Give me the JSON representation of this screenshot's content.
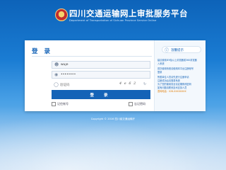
{
  "header": {
    "title": "四川交通运输网上审批服务平台",
    "subtitle": "Department of Transportation of Sichuan Province Service Online",
    "emblem_icon": "emblem-icon"
  },
  "login": {
    "title": "登 录",
    "username": {
      "icon": "user-icon",
      "placeholder": "用户名",
      "value": "wuje"
    },
    "password": {
      "icon": "lock-icon",
      "value": "••••••••"
    },
    "captcha": {
      "icon": "shield-icon",
      "placeholder": "验证码",
      "image_text": "4 e 6 2",
      "refresh_icon": "refresh-icon"
    },
    "button": "登  录",
    "remember": "记住帐号",
    "forgot": "忘记密码"
  },
  "tips": {
    "title": "温馨提示",
    "icon": "info-icon",
    "lines": [
      "建议使用IE9及以上浏览器或360浏览器",
      "入系统",
      "首次使用系统请使用本平台注册帐号",
      "登录",
      "所属单位人员请先进行注册申请",
      "注册成功后请登录系统",
      "为了您的使用安全请定期修改密码",
      "如有问题请联系技术支持人员",
      "咨询电话：028-XXXXXXXX"
    ]
  },
  "footer": {
    "copyright": "Copyright © 2016  四川省交通运输厅"
  },
  "colors": {
    "brand": "#1463b7",
    "accent": "#e07a00"
  }
}
